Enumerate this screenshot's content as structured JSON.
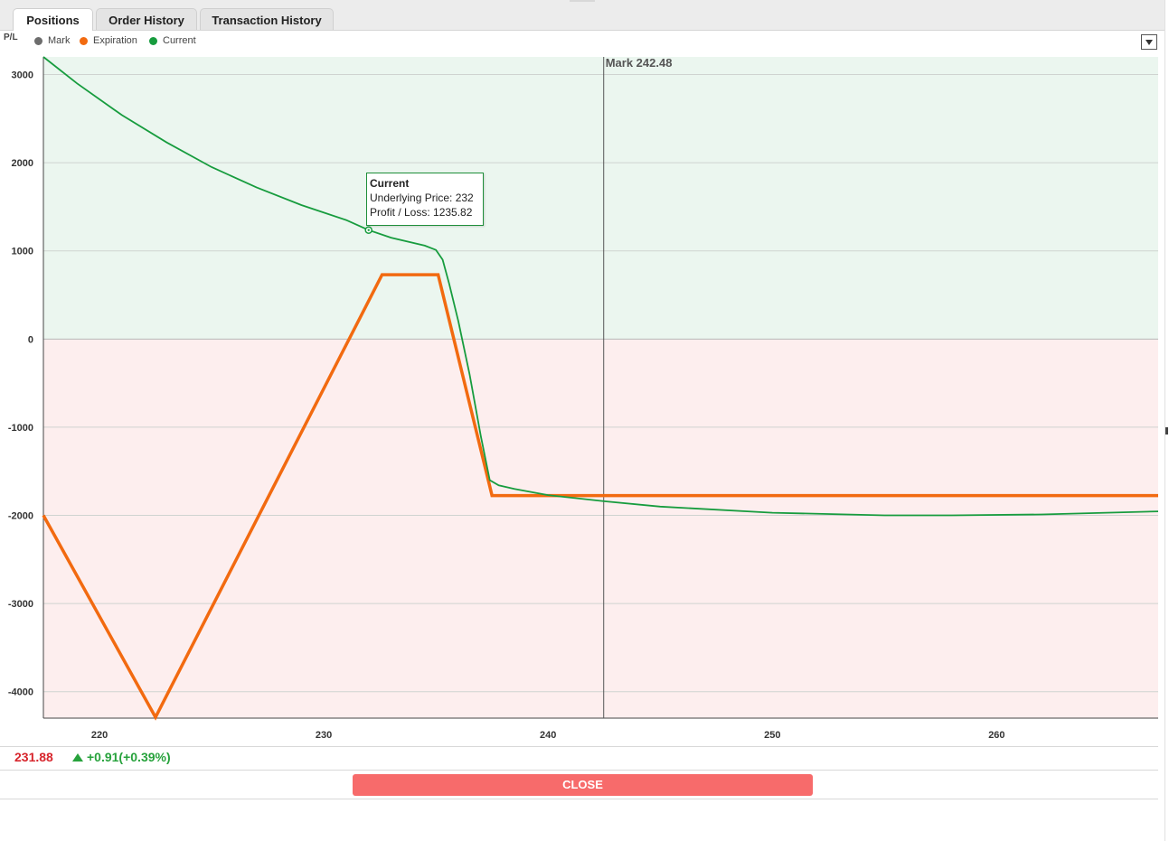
{
  "tabs": [
    {
      "label": "Positions",
      "active": true
    },
    {
      "label": "Order History",
      "active": false
    },
    {
      "label": "Transaction History",
      "active": false
    }
  ],
  "legend": {
    "axis_label": "P/L",
    "items": [
      {
        "label": "Mark",
        "color": "#6d6d6d"
      },
      {
        "label": "Expiration",
        "color": "#f26a10"
      },
      {
        "label": "Current",
        "color": "#179c3e"
      }
    ],
    "menu_icon": "dropdown-icon"
  },
  "chart_data": {
    "type": "line",
    "title": "",
    "xlabel": "",
    "ylabel": "P/L",
    "xlim": [
      217.5,
      267.2
    ],
    "ylim": [
      -4300,
      3200
    ],
    "x_ticks": [
      220,
      230,
      240,
      250,
      260
    ],
    "y_ticks": [
      3000,
      2000,
      1000,
      0,
      -1000,
      -2000,
      -3000,
      -4000
    ],
    "grid": true,
    "zones": {
      "profit_color": "#ebf6ef",
      "loss_color": "#fdeeee"
    },
    "mark_line": {
      "label": "Mark 242.48",
      "x": 242.48
    },
    "series": [
      {
        "name": "Expiration",
        "color": "#f26a10",
        "points": [
          [
            217.5,
            -2000
          ],
          [
            222.5,
            -4290
          ],
          [
            232.6,
            730
          ],
          [
            235.1,
            730
          ],
          [
            237.5,
            -1775
          ],
          [
            267.2,
            -1775
          ]
        ]
      },
      {
        "name": "Current",
        "color": "#179c3e",
        "points": [
          [
            217.5,
            3200
          ],
          [
            219,
            2900
          ],
          [
            221,
            2540
          ],
          [
            223,
            2230
          ],
          [
            225,
            1950
          ],
          [
            227,
            1720
          ],
          [
            229,
            1520
          ],
          [
            231,
            1350
          ],
          [
            232,
            1236
          ],
          [
            233,
            1150
          ],
          [
            234.5,
            1060
          ],
          [
            235.0,
            1010
          ],
          [
            235.3,
            900
          ],
          [
            235.6,
            620
          ],
          [
            236,
            200
          ],
          [
            236.5,
            -400
          ],
          [
            237,
            -1100
          ],
          [
            237.4,
            -1600
          ],
          [
            237.8,
            -1660
          ],
          [
            238.5,
            -1700
          ],
          [
            240,
            -1770
          ],
          [
            242.5,
            -1840
          ],
          [
            245,
            -1900
          ],
          [
            250,
            -1970
          ],
          [
            255,
            -2000
          ],
          [
            258,
            -2000
          ],
          [
            262,
            -1990
          ],
          [
            267.2,
            -1955
          ]
        ]
      }
    ],
    "tooltip": {
      "title": "Current",
      "line1": "Underlying Price: 232",
      "line2": "Profit / Loss: 1235.82",
      "x": 232,
      "y": 1235.82
    }
  },
  "quote": {
    "last": "231.88",
    "change": "+0.91(+0.39%)",
    "change_icon": "up-arrow-icon"
  },
  "actions": {
    "close_label": "CLOSE"
  }
}
